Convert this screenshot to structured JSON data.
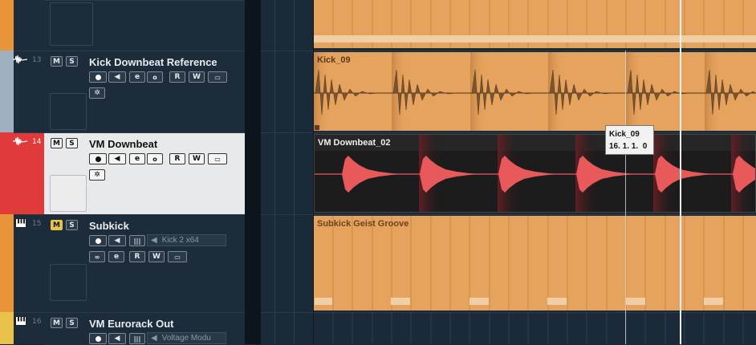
{
  "tracks": [
    {
      "number": "",
      "name": "",
      "type": "instrument"
    },
    {
      "number": "13",
      "name": "Kick Downbeat Reference",
      "type": "audio",
      "event_name": "Kick_09"
    },
    {
      "number": "14",
      "name": "VM Downbeat",
      "type": "audio",
      "event_name": "VM Downbeat_02",
      "selected": true
    },
    {
      "number": "15",
      "name": "Subkick",
      "type": "instrument",
      "output": "Kick 2 x64",
      "event_name": "Subkick Geist Groove"
    },
    {
      "number": "16",
      "name": "VM Eurorack Out",
      "type": "instrument",
      "output": "Voltage Modu"
    }
  ],
  "buttons": {
    "mute": "M",
    "solo": "S",
    "read": "R",
    "write": "W",
    "edit": "e"
  },
  "tooltip": {
    "name": "Kick_09",
    "position": "16. 1. 1.  0"
  },
  "colors": {
    "track1": "#e8953a",
    "track13": "#9fb0c0",
    "track14": "#e03a3a",
    "track15": "#e8953a",
    "track16": "#e8c24a",
    "event_orange": "#e6a35e",
    "audio_dark": "#1c1c1c",
    "waveform_red": "#e85a5a",
    "bg": "#17222c"
  },
  "icons": [
    "waveform-icon",
    "piano-icon",
    "mute-icon",
    "solo-icon",
    "record-icon",
    "monitor-icon",
    "edit-icon",
    "read-icon",
    "write-icon",
    "lanes-icon",
    "freeze-icon",
    "midi-icon"
  ]
}
